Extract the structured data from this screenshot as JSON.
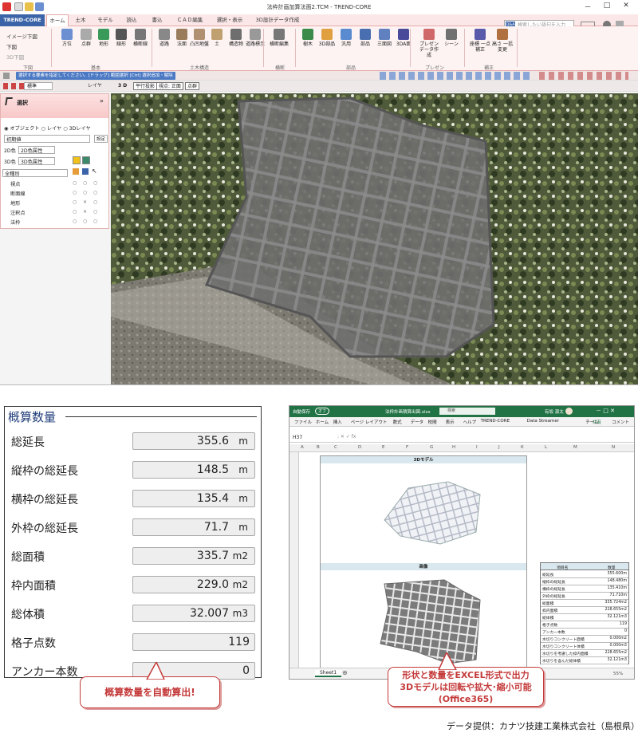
{
  "app": {
    "window_title": "法枠計画加算法面2.TCM - TREND-CORE",
    "window_controls": [
      "－",
      "□",
      "✕"
    ],
    "tabs": [
      "TREND-CORE",
      "ホーム",
      "土木",
      "モデル",
      "読込",
      "書込",
      "ＣＡＤ編集",
      "選択・表示",
      "3D設計データ作成"
    ],
    "search_placeholder": "検索したい語句を入力",
    "search_badge": "Q&A",
    "ribbon_left": [
      "イメージ下図",
      "下図",
      "3D下図"
    ],
    "ribbon_buttons": [
      {
        "label": "方位"
      },
      {
        "label": "点群"
      },
      {
        "label": "地形"
      },
      {
        "label": "線形"
      },
      {
        "label": "横断線"
      },
      {
        "label": "道路"
      },
      {
        "label": "法面"
      },
      {
        "label": "凸凹地盤"
      },
      {
        "label": "土"
      },
      {
        "label": "構造物"
      },
      {
        "label": "道路標示"
      },
      {
        "label": "横断編集"
      },
      {
        "label": "樹木"
      },
      {
        "label": "3D部品"
      },
      {
        "label": "汎用"
      },
      {
        "label": "部品"
      },
      {
        "label": "三面図"
      },
      {
        "label": "3DA面"
      },
      {
        "label": "プレゼン データ作成"
      },
      {
        "label": "シーン"
      },
      {
        "label": "座標 一点補正"
      },
      {
        "label": "高さ 一括変更"
      }
    ],
    "ribbon_groups": [
      "下図",
      "基本",
      "土木構造",
      "横断",
      "部品",
      "プレゼン",
      "補正"
    ],
    "status_message": "選択する要素を指定してください。[ドラッグ] 範囲選択 [Ctrl] 選択追加・解除",
    "toolbar3": {
      "mode": "標準",
      "layer": "レイヤ",
      "view3d": "3 D",
      "parallel": "平行投影",
      "viewpoint": "視点: 正面",
      "pointgroup": "点群"
    }
  },
  "panel": {
    "title": "選択",
    "radios": [
      "オブジェクト",
      "レイヤ",
      "3Dレイヤ"
    ],
    "initial": "初期値",
    "settings": "設定",
    "attr2d_label": "2D色",
    "attr2d_value": "2D色属性",
    "attr3d_label": "3D色",
    "attr3d_value": "3D色属性",
    "filter": "全種別",
    "items": [
      "視点",
      "断面線",
      "地形",
      "注釈点",
      "法枠"
    ]
  },
  "summary": {
    "title": "概算数量",
    "rows": [
      {
        "label": "総延長",
        "value": "355.6",
        "unit": "m"
      },
      {
        "label": "縦枠の総延長",
        "value": "148.5",
        "unit": "m"
      },
      {
        "label": "横枠の総延長",
        "value": "135.4",
        "unit": "m"
      },
      {
        "label": "外枠の総延長",
        "value": "71.7",
        "unit": "m"
      },
      {
        "label": "総面積",
        "value": "335.7",
        "unit": "m2"
      },
      {
        "label": "枠内面積",
        "value": "229.0",
        "unit": "m2"
      },
      {
        "label": "総体積",
        "value": "32.007",
        "unit": "m3"
      },
      {
        "label": "格子点数",
        "value": "119",
        "unit": ""
      },
      {
        "label": "アンカー本数",
        "value": "0",
        "unit": ""
      }
    ]
  },
  "excel": {
    "autosave": "自動保存",
    "toggle": "オフ",
    "filename": "法枠計画積算出図.xlsx",
    "search": "検索",
    "user": "有坂 源太",
    "menu": [
      "ファイル",
      "ホーム",
      "挿入",
      "ページ レイアウト",
      "数式",
      "データ",
      "校閲",
      "表示",
      "ヘルプ",
      "TREND-CORE",
      "Data Streamer",
      "チーム"
    ],
    "share": "共有",
    "comment": "コメント",
    "cell_ref": "H37",
    "columns": [
      "A",
      "B",
      "C",
      "D",
      "E",
      "F",
      "G",
      "H",
      "I",
      "J",
      "K",
      "L",
      "M",
      "N"
    ],
    "model_title": "3Dモデル",
    "image_title": "画像",
    "table_head": [
      "項目名",
      "数量"
    ],
    "table_rows": [
      [
        "総延長",
        "355.600m"
      ],
      [
        "縦枠の総延長",
        "148.480m"
      ],
      [
        "横枠の総延長",
        "135.410m"
      ],
      [
        "外枠の総延長",
        "71.710m"
      ],
      [
        "総面積",
        "335.724m2"
      ],
      [
        "枠内面積",
        "228.655m2"
      ],
      [
        "総体積",
        "32.121m3"
      ],
      [
        "格子点数",
        "119"
      ],
      [
        "アンカー本数",
        "0"
      ],
      [
        "水切りコンクリート面積",
        "0.000m2"
      ],
      [
        "水切りコンクリート体積",
        "0.000m3"
      ],
      [
        "水切りを考慮した枠内面積",
        "228.655m2"
      ],
      [
        "水切りを含んだ総体積",
        "32.121m3"
      ]
    ],
    "sheet_tab": "Sheet1",
    "zoom": "55%"
  },
  "callouts": {
    "auto": "概算数量を自動算出!",
    "excel_lines": [
      "形状と数量をEXCEL形式で出力",
      "3Dモデルは回転や拡大･縮小可能",
      "(Office365)"
    ]
  },
  "credit": "データ提供：カナツ技建工業株式会社（島根県）",
  "colors": {
    "accent_pink": "#f8c8c8",
    "brand_blue": "#3a63a8",
    "excel_green": "#217346",
    "callout_red": "#c43a3a"
  }
}
